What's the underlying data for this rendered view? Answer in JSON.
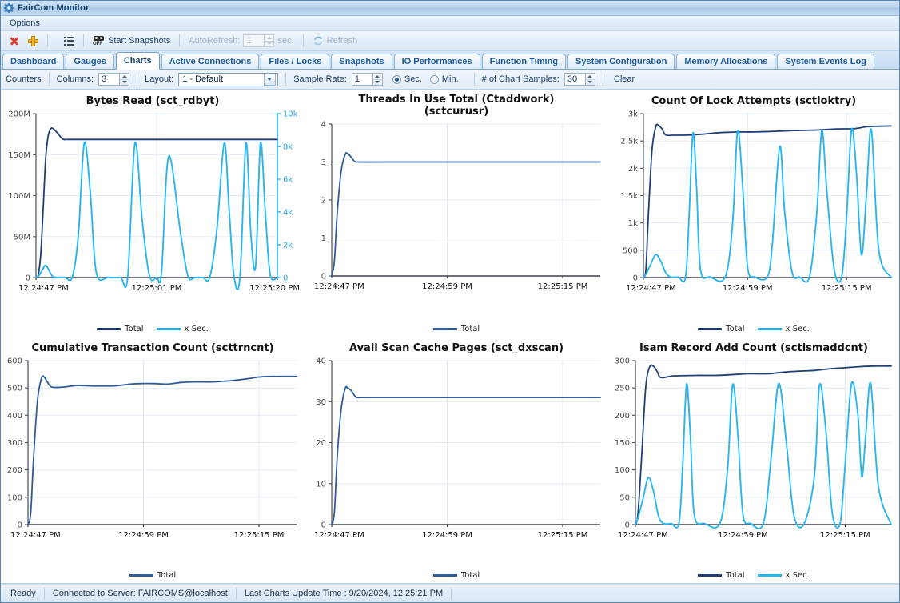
{
  "window": {
    "title": "FairCom Monitor",
    "icon": "gear-icon"
  },
  "menu": {
    "items": [
      "Options"
    ]
  },
  "toolbar": {
    "close_icon": "red-x-icon",
    "add_icon": "yellow-plus-icon",
    "list_icon": "list-icon",
    "snapshot_icon": "camera-off-icon",
    "start_snapshots_label": "Start Snapshots",
    "autorefresh_label": "AutoRefresh:",
    "autorefresh_value": "1",
    "sec_label": "sec.",
    "refresh_icon": "refresh-icon",
    "refresh_label": "Refresh"
  },
  "tabs": [
    {
      "label": "Dashboard",
      "active": false
    },
    {
      "label": "Gauges",
      "active": false
    },
    {
      "label": "Charts",
      "active": true
    },
    {
      "label": "Active Connections",
      "active": false
    },
    {
      "label": "Files / Locks",
      "active": false
    },
    {
      "label": "Snapshots",
      "active": false
    },
    {
      "label": "IO Performances",
      "active": false
    },
    {
      "label": "Function Timing",
      "active": false
    },
    {
      "label": "System Configuration",
      "active": false
    },
    {
      "label": "Memory Allocations",
      "active": false
    },
    {
      "label": "System Events Log",
      "active": false
    }
  ],
  "counters_bar": {
    "counters_label": "Counters",
    "columns_label": "Columns:",
    "columns_value": "3",
    "layout_label": "Layout:",
    "layout_value": "1 - Default",
    "sample_rate_label": "Sample Rate:",
    "sample_rate_value": "1",
    "sec_label": "Sec.",
    "min_label": "Min.",
    "unit_selected": "Sec.",
    "chart_samples_label": "# of Chart Samples:",
    "chart_samples_value": "30",
    "clear_label": "Clear"
  },
  "statusbar": {
    "ready": "Ready",
    "connection": "Connected to Server: FAIRCOMS@localhost",
    "last_update": "Last Charts Update Time : 9/20/2024, 12:25:21 PM"
  },
  "colors": {
    "total_series": "#1f3f77",
    "xsec_series": "#29b6f0",
    "grid": "#dfe9f2",
    "axis": "#333333",
    "axis2": "#29a3dd"
  },
  "chart_data": [
    {
      "type": "line",
      "title": "Bytes Read (sct_rdbyt)",
      "title_lines": [
        "Bytes Read (sct_rdbyt)"
      ],
      "xlabel": "",
      "ylabel": "",
      "ylim": [
        0,
        200000000
      ],
      "yticks": [
        0,
        50000000,
        100000000,
        150000000,
        200000000
      ],
      "yticklabels": [
        "0",
        "50M",
        "100M",
        "150M",
        "200M"
      ],
      "y2lim": [
        0,
        10000
      ],
      "y2ticks": [
        0,
        2000,
        4000,
        6000,
        8000,
        10000
      ],
      "y2ticklabels": [
        "0",
        "2k",
        "4k",
        "6k",
        "8k",
        "10k"
      ],
      "xticklabels": [
        "12:24:47 PM",
        "12:25:01 PM",
        "12:25:20 PM"
      ],
      "xtickpos": [
        0.0,
        0.5,
        1.0
      ],
      "grid": true,
      "legend": [
        {
          "name": "Total",
          "color": "#1f3f77"
        },
        {
          "name": "x Sec.",
          "color": "#29b6f0"
        }
      ],
      "series": [
        {
          "name": "Total",
          "axis": "left",
          "color": "#1f3f77",
          "x": [
            0,
            0.01,
            0.02,
            0.03,
            0.04,
            0.05,
            0.06,
            0.07,
            0.09,
            0.11,
            0.13,
            0.16,
            0.2,
            0.3,
            0.45,
            0.6,
            0.75,
            0.9,
            1.0
          ],
          "values": [
            0,
            4000000,
            30000000,
            85000000,
            145000000,
            172000000,
            181000000,
            182000000,
            176000000,
            169000000,
            168500000,
            168500000,
            168500000,
            168500000,
            168500000,
            168500000,
            168500000,
            168500000,
            168500000
          ]
        },
        {
          "name": "x Sec.",
          "axis": "right",
          "color": "#29b6f0",
          "x": [
            0,
            0.01,
            0.025,
            0.04,
            0.055,
            0.07,
            0.09,
            0.12,
            0.15,
            0.175,
            0.2,
            0.225,
            0.25,
            0.3,
            0.35,
            0.38,
            0.41,
            0.44,
            0.47,
            0.5,
            0.52,
            0.55,
            0.6,
            0.63,
            0.66,
            0.69,
            0.72,
            0.75,
            0.78,
            0.8,
            0.82,
            0.845,
            0.87,
            0.89,
            0.91,
            0.93,
            0.95,
            0.97,
            1.0
          ],
          "values": [
            0,
            80,
            430,
            760,
            400,
            60,
            10,
            10,
            10,
            2500,
            8200,
            5200,
            300,
            10,
            10,
            10,
            8200,
            3500,
            120,
            10,
            300,
            7400,
            2600,
            80,
            10,
            10,
            10,
            3000,
            8200,
            4200,
            120,
            10,
            8200,
            2700,
            700,
            8200,
            4000,
            200,
            0
          ]
        }
      ]
    },
    {
      "type": "line",
      "title": "Threads In Use Total (Ctaddwork) (sctcurusr)",
      "title_lines": [
        "Threads In Use Total (Ctaddwork)",
        "(sctcurusr)"
      ],
      "xlabel": "",
      "ylabel": "",
      "ylim": [
        0,
        4
      ],
      "yticks": [
        0,
        1,
        2,
        3,
        4
      ],
      "yticklabels": [
        "0",
        "1",
        "2",
        "3",
        "4"
      ],
      "xticklabels": [
        "12:24:47 PM",
        "12:24:59 PM",
        "12:25:15 PM"
      ],
      "xtickpos": [
        0.0,
        0.43,
        0.86
      ],
      "grid": true,
      "legend": [
        {
          "name": "Total",
          "color": "#2f5d99"
        }
      ],
      "series": [
        {
          "name": "Total",
          "axis": "left",
          "color": "#2f5d99",
          "x": [
            0,
            0.01,
            0.02,
            0.035,
            0.05,
            0.06,
            0.07,
            0.085,
            0.1,
            0.2,
            0.4,
            0.6,
            0.8,
            1.0
          ],
          "values": [
            0,
            0.4,
            1.6,
            2.75,
            3.2,
            3.22,
            3.15,
            3.02,
            3.0,
            3.0,
            3.0,
            3.0,
            3.0,
            3.0
          ]
        }
      ]
    },
    {
      "type": "line",
      "title": "Count Of Lock Attempts (sctloktry)",
      "title_lines": [
        "Count Of Lock Attempts (sctloktry)"
      ],
      "xlabel": "",
      "ylabel": "",
      "ylim": [
        0,
        3000
      ],
      "yticks": [
        0,
        500,
        1000,
        1500,
        2000,
        2500,
        3000
      ],
      "yticklabels": [
        "0",
        "500",
        "1k",
        "1.5k",
        "2k",
        "2.5k",
        "3k"
      ],
      "xticklabels": [
        "12:24:47 PM",
        "12:24:59 PM",
        "12:25:15 PM"
      ],
      "xtickpos": [
        0.0,
        0.42,
        0.82
      ],
      "grid": true,
      "legend": [
        {
          "name": "Total",
          "color": "#1f3f77"
        },
        {
          "name": "x Sec.",
          "color": "#29b6f0"
        }
      ],
      "series": [
        {
          "name": "Total",
          "axis": "left",
          "color": "#1f3f77",
          "x": [
            0,
            0.01,
            0.02,
            0.035,
            0.05,
            0.06,
            0.075,
            0.09,
            0.12,
            0.2,
            0.3,
            0.35,
            0.4,
            0.45,
            0.55,
            0.6,
            0.65,
            0.7,
            0.78,
            0.85,
            0.9,
            0.95,
            1.0
          ],
          "values": [
            0,
            150,
            1150,
            2350,
            2760,
            2790,
            2720,
            2610,
            2605,
            2610,
            2650,
            2660,
            2665,
            2665,
            2680,
            2690,
            2695,
            2700,
            2720,
            2725,
            2760,
            2770,
            2775
          ]
        },
        {
          "name": "x Sec.",
          "axis": "left",
          "color": "#29b6f0",
          "x": [
            0,
            0.01,
            0.03,
            0.05,
            0.07,
            0.09,
            0.11,
            0.14,
            0.17,
            0.185,
            0.2,
            0.215,
            0.23,
            0.27,
            0.33,
            0.36,
            0.38,
            0.4,
            0.42,
            0.45,
            0.5,
            0.52,
            0.55,
            0.57,
            0.6,
            0.63,
            0.67,
            0.7,
            0.72,
            0.74,
            0.77,
            0.8,
            0.82,
            0.84,
            0.86,
            0.88,
            0.9,
            0.92,
            0.95,
            1.0
          ],
          "values": [
            0,
            60,
            250,
            420,
            300,
            90,
            10,
            10,
            10,
            1200,
            2650,
            1600,
            150,
            10,
            10,
            1000,
            2680,
            1700,
            200,
            10,
            10,
            600,
            2400,
            1200,
            100,
            10,
            10,
            1200,
            2690,
            1600,
            150,
            10,
            1100,
            2710,
            1900,
            420,
            1500,
            2700,
            500,
            0
          ]
        }
      ]
    },
    {
      "type": "line",
      "title": "Cumulative Transaction Count (scttrncnt)",
      "title_lines": [
        "Cumulative Transaction Count (scttrncnt)"
      ],
      "xlabel": "",
      "ylabel": "",
      "ylim": [
        0,
        600
      ],
      "yticks": [
        0,
        100,
        200,
        300,
        400,
        500,
        600
      ],
      "yticklabels": [
        "0",
        "100",
        "200",
        "300",
        "400",
        "500",
        "600"
      ],
      "xticklabels": [
        "12:24:47 PM",
        "12:24:59 PM",
        "12:25:15 PM"
      ],
      "xtickpos": [
        0.0,
        0.43,
        0.86
      ],
      "grid": true,
      "legend": [
        {
          "name": "Total",
          "color": "#2f5d99"
        }
      ],
      "series": [
        {
          "name": "Total",
          "axis": "left",
          "color": "#2f5d99",
          "x": [
            0,
            0.01,
            0.02,
            0.035,
            0.05,
            0.06,
            0.07,
            0.085,
            0.1,
            0.13,
            0.18,
            0.22,
            0.27,
            0.33,
            0.38,
            0.42,
            0.47,
            0.52,
            0.57,
            0.62,
            0.68,
            0.72,
            0.77,
            0.82,
            0.86,
            0.9,
            0.95,
            1.0
          ],
          "values": [
            0,
            40,
            230,
            450,
            535,
            540,
            525,
            505,
            502,
            503,
            509,
            508,
            507,
            508,
            514,
            516,
            516,
            514,
            520,
            522,
            522,
            524,
            528,
            534,
            540,
            542,
            542,
            542
          ]
        }
      ]
    },
    {
      "type": "line",
      "title": "Avail Scan Cache Pages (sct_dxscan)",
      "title_lines": [
        "Avail Scan Cache Pages (sct_dxscan)"
      ],
      "xlabel": "",
      "ylabel": "",
      "ylim": [
        0,
        40
      ],
      "yticks": [
        0,
        10,
        20,
        30,
        40
      ],
      "yticklabels": [
        "0",
        "10",
        "20",
        "30",
        "40"
      ],
      "xticklabels": [
        "12:24:47 PM",
        "12:24:59 PM",
        "12:25:15 PM"
      ],
      "xtickpos": [
        0.0,
        0.43,
        0.86
      ],
      "grid": true,
      "legend": [
        {
          "name": "Total",
          "color": "#2f5d99"
        }
      ],
      "series": [
        {
          "name": "Total",
          "axis": "left",
          "color": "#2f5d99",
          "x": [
            0,
            0.01,
            0.02,
            0.035,
            0.05,
            0.06,
            0.075,
            0.09,
            0.11,
            0.2,
            0.4,
            0.6,
            0.8,
            1.0
          ],
          "values": [
            0,
            3,
            16,
            28,
            33.2,
            33.3,
            32.5,
            31.1,
            31,
            31,
            31,
            31,
            31,
            31
          ]
        }
      ]
    },
    {
      "type": "line",
      "title": "Isam Record Add Count (sctismaddcnt)",
      "title_lines": [
        "Isam Record Add Count (sctismaddcnt)"
      ],
      "xlabel": "",
      "ylabel": "",
      "ylim": [
        0,
        300
      ],
      "yticks": [
        0,
        50,
        100,
        150,
        200,
        250,
        300
      ],
      "yticklabels": [
        "0",
        "50",
        "100",
        "150",
        "200",
        "250",
        "300"
      ],
      "xticklabels": [
        "12:24:47 PM",
        "12:24:59 PM",
        "12:25:15 PM"
      ],
      "xtickpos": [
        0.0,
        0.42,
        0.82
      ],
      "grid": true,
      "legend": [
        {
          "name": "Total",
          "color": "#1f3f77"
        },
        {
          "name": "x Sec.",
          "color": "#29b6f0"
        }
      ],
      "series": [
        {
          "name": "Total",
          "axis": "left",
          "color": "#1f3f77",
          "x": [
            0,
            0.01,
            0.025,
            0.04,
            0.055,
            0.07,
            0.085,
            0.1,
            0.15,
            0.25,
            0.32,
            0.4,
            0.45,
            0.52,
            0.58,
            0.65,
            0.7,
            0.76,
            0.82,
            0.88,
            0.93,
            1.0
          ],
          "values": [
            0,
            20,
            130,
            250,
            288,
            290,
            280,
            269,
            272,
            273,
            273,
            275,
            276,
            276,
            279,
            281,
            282,
            285,
            287,
            289,
            290,
            290
          ]
        },
        {
          "name": "x Sec.",
          "axis": "left",
          "color": "#29b6f0",
          "x": [
            0,
            0.01,
            0.03,
            0.05,
            0.07,
            0.09,
            0.11,
            0.14,
            0.17,
            0.185,
            0.2,
            0.215,
            0.23,
            0.27,
            0.33,
            0.36,
            0.38,
            0.4,
            0.42,
            0.45,
            0.5,
            0.53,
            0.56,
            0.59,
            0.62,
            0.66,
            0.7,
            0.72,
            0.745,
            0.77,
            0.8,
            0.82,
            0.845,
            0.87,
            0.885,
            0.9,
            0.92,
            0.95,
            1.0
          ],
          "values": [
            0,
            12,
            48,
            86,
            62,
            16,
            2,
            2,
            2,
            110,
            257,
            160,
            18,
            2,
            2,
            100,
            256,
            168,
            20,
            2,
            2,
            120,
            258,
            150,
            16,
            2,
            90,
            256,
            170,
            20,
            2,
            110,
            258,
            200,
            88,
            160,
            258,
            70,
            0
          ]
        }
      ]
    }
  ]
}
